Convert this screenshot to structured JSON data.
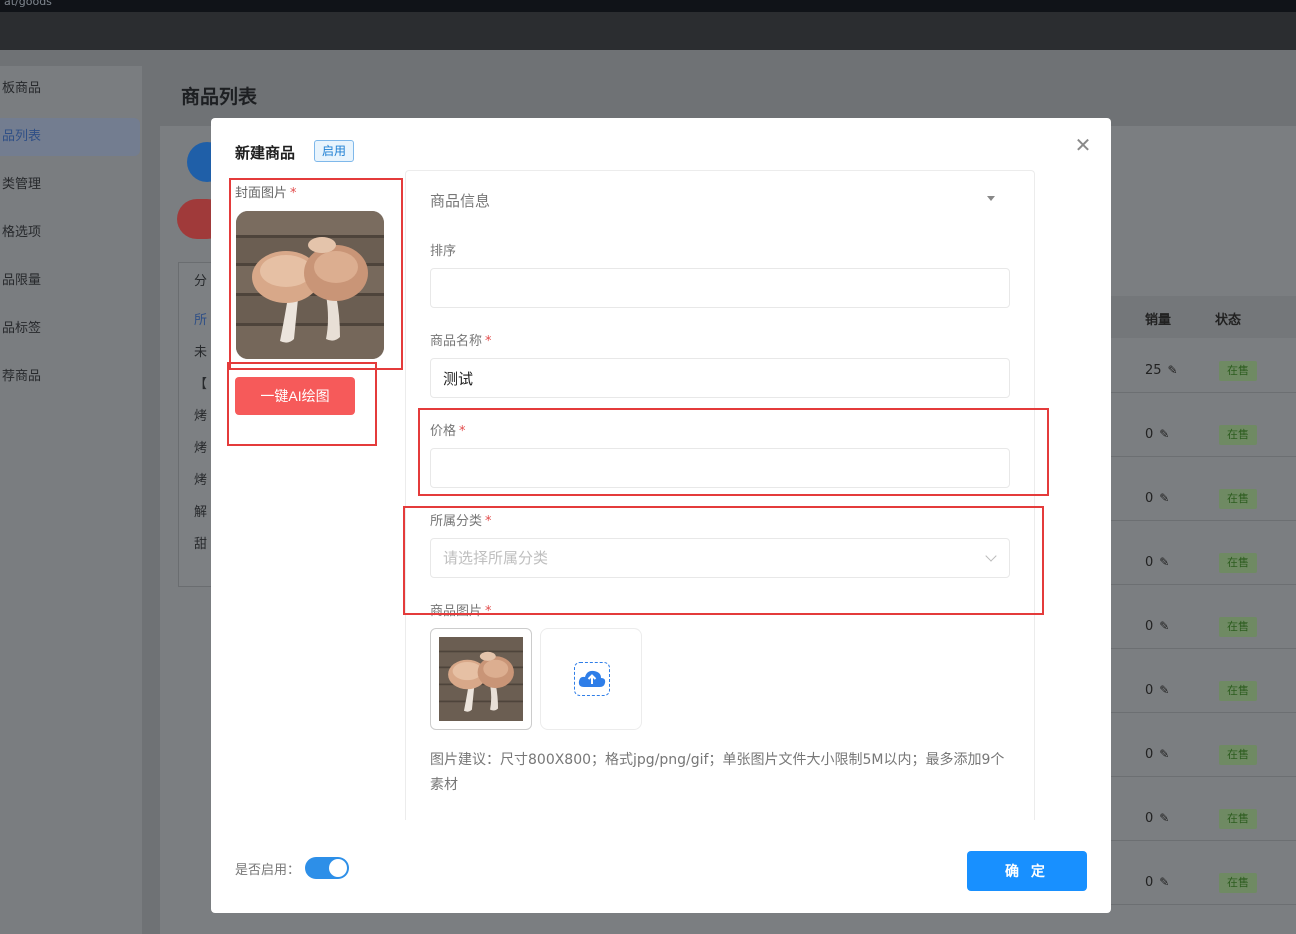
{
  "browser": {
    "url_fragment": "at/goods"
  },
  "sidebar": {
    "items": [
      {
        "label": "板商品"
      },
      {
        "label": "品列表"
      },
      {
        "label": "类管理"
      },
      {
        "label": "格选项"
      },
      {
        "label": "品限量"
      },
      {
        "label": "品标签"
      },
      {
        "label": "荐商品"
      }
    ]
  },
  "main": {
    "title": "商品列表"
  },
  "categories": {
    "items": [
      "分",
      "所",
      "未",
      "【",
      "烤",
      "烤",
      "烤",
      "解",
      "甜"
    ]
  },
  "table": {
    "headers": {
      "sales": "销量",
      "status": "状态"
    },
    "rows": [
      {
        "sales": "25",
        "status": "在售"
      },
      {
        "sales": "0",
        "status": "在售"
      },
      {
        "sales": "0",
        "status": "在售"
      },
      {
        "sales": "0",
        "status": "在售"
      },
      {
        "sales": "0",
        "status": "在售"
      },
      {
        "sales": "0",
        "status": "在售"
      },
      {
        "sales": "0",
        "status": "在售"
      },
      {
        "sales": "0",
        "status": "在售"
      },
      {
        "sales": "0",
        "status": "在售"
      }
    ]
  },
  "modal": {
    "title": "新建商品",
    "status_badge": "启用",
    "cover": {
      "label": "封面图片",
      "required_mark": "*"
    },
    "ai_button": "一键AI绘图",
    "section_head": "商品信息",
    "fields": {
      "sort": {
        "label": "排序",
        "value": ""
      },
      "name": {
        "label": "商品名称",
        "required_mark": "*",
        "value": "测试"
      },
      "price": {
        "label": "价格",
        "required_mark": "*",
        "value": ""
      },
      "category": {
        "label": "所属分类",
        "required_mark": "*",
        "placeholder": "请选择所属分类"
      },
      "images": {
        "label": "商品图片",
        "required_mark": "*"
      }
    },
    "image_hint": "图片建议：尺寸800X800；格式jpg/png/gif；单张图片文件大小限制5M以内；最多添加9个素材",
    "enable_label": "是否启用：",
    "enable_toggle_on": true,
    "confirm_button": "确 定",
    "colors": {
      "primary": "#1890ff",
      "ai_button": "#f65a5a",
      "annotation": "#e43b3b"
    }
  }
}
